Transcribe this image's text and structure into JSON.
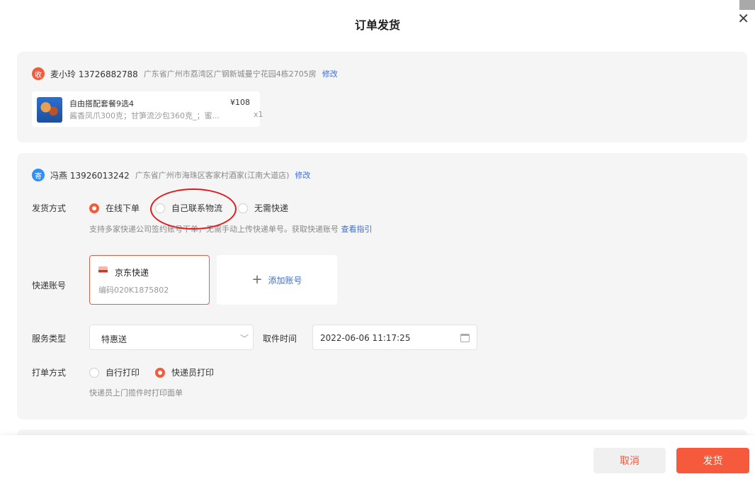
{
  "dialog": {
    "title": "订单发货"
  },
  "receiver": {
    "badge": "收",
    "name_phone": "麦小玲 13726882788",
    "address": "广东省广州市荔湾区广钢新城曼宁花园4栋2705房",
    "edit_label": "修改"
  },
  "product": {
    "name": "自由搭配套餐9选4",
    "price": "¥108",
    "spec": "酱香凤爪300克；甘笋流沙包360克_；蜜...",
    "qty": "x1"
  },
  "sender": {
    "badge": "寄",
    "name_phone": "冯燕 13926013242",
    "address": "广东省广州市海珠区客家村酒家(江南大道店)",
    "edit_label": "修改"
  },
  "ship_method": {
    "label": "发货方式",
    "options": [
      "在线下单",
      "自己联系物流",
      "无需快递"
    ],
    "selected": "在线下单",
    "hint": "支持多家快递公司签约账号下单，无需手动上传快递单号。获取快递账号",
    "hint_link": "查看指引"
  },
  "express_account": {
    "label": "快递账号",
    "name": "京东快递",
    "code": "编码020K1875802",
    "add_label": "添加账号"
  },
  "service_type": {
    "label": "服务类型",
    "value": "特惠送",
    "pickup_label": "取件时间",
    "pickup_time": "2022-06-06 11:17:25"
  },
  "print_method": {
    "label": "打单方式",
    "options": [
      "自行打印",
      "快递员打印"
    ],
    "selected": "快递员打印",
    "hint": "快递员上门揽件时打印面单"
  },
  "footer": {
    "cancel_label": "取消",
    "ship_label": "发货"
  },
  "colors": {
    "accent": "#f55a3c",
    "link": "#3a6fd8",
    "sender_badge": "#2f8ef7",
    "annotation": "#e01b1b"
  }
}
